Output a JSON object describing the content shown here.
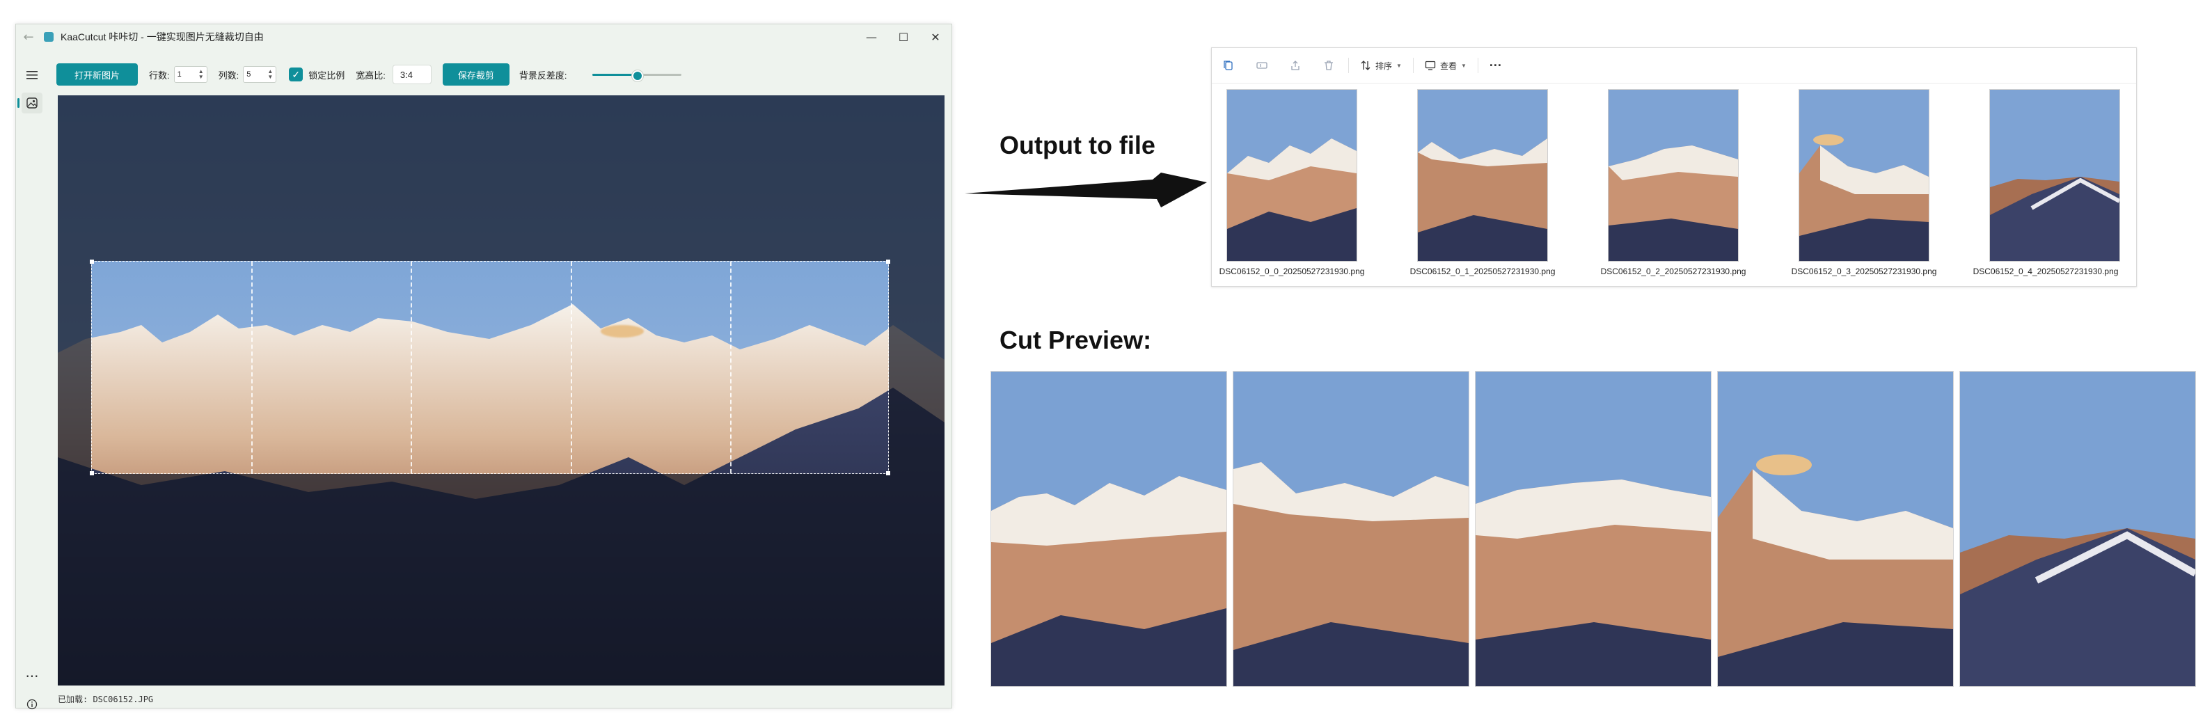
{
  "window": {
    "title": "KaaCutcut 咔咔切 - 一键实现图片无缝裁切自由",
    "back_icon": "back-arrow-icon",
    "controls": {
      "minimize": "—",
      "maximize": "☐",
      "close": "✕"
    }
  },
  "nav": {
    "menu_icon": "hamburger-menu-icon",
    "image_icon": "image-icon",
    "more_icon": "more-dots-icon",
    "info_icon": "info-icon"
  },
  "toolbar": {
    "open_button": "打开新图片",
    "rows_label": "行数:",
    "rows_value": "1",
    "cols_label": "列数:",
    "cols_value": "5",
    "lock_ratio_label": "锁定比例",
    "lock_ratio_checked": true,
    "aspect_label": "宽高比:",
    "aspect_value": "3:4",
    "save_button": "保存裁剪",
    "bg_shift_label": "背景反差度:",
    "bg_shift_level": 0.5
  },
  "status": {
    "loaded": "已加载: DSC06152.JPG"
  },
  "arrow_caption": "Output to file",
  "preview_caption": "Cut Preview:",
  "explorer": {
    "toolbar": {
      "sort_label": "排序",
      "view_label": "查看",
      "more": "···"
    },
    "files": [
      "DSC06152_0_0_20250527231930.png",
      "DSC06152_0_1_20250527231930.png",
      "DSC06152_0_2_20250527231930.png",
      "DSC06152_0_3_20250527231930.png",
      "DSC06152_0_4_20250527231930.png"
    ]
  },
  "colors": {
    "accent": "#0f8f9a",
    "window_bg": "#eef3ee",
    "canvas_bg": "#232a3b"
  }
}
